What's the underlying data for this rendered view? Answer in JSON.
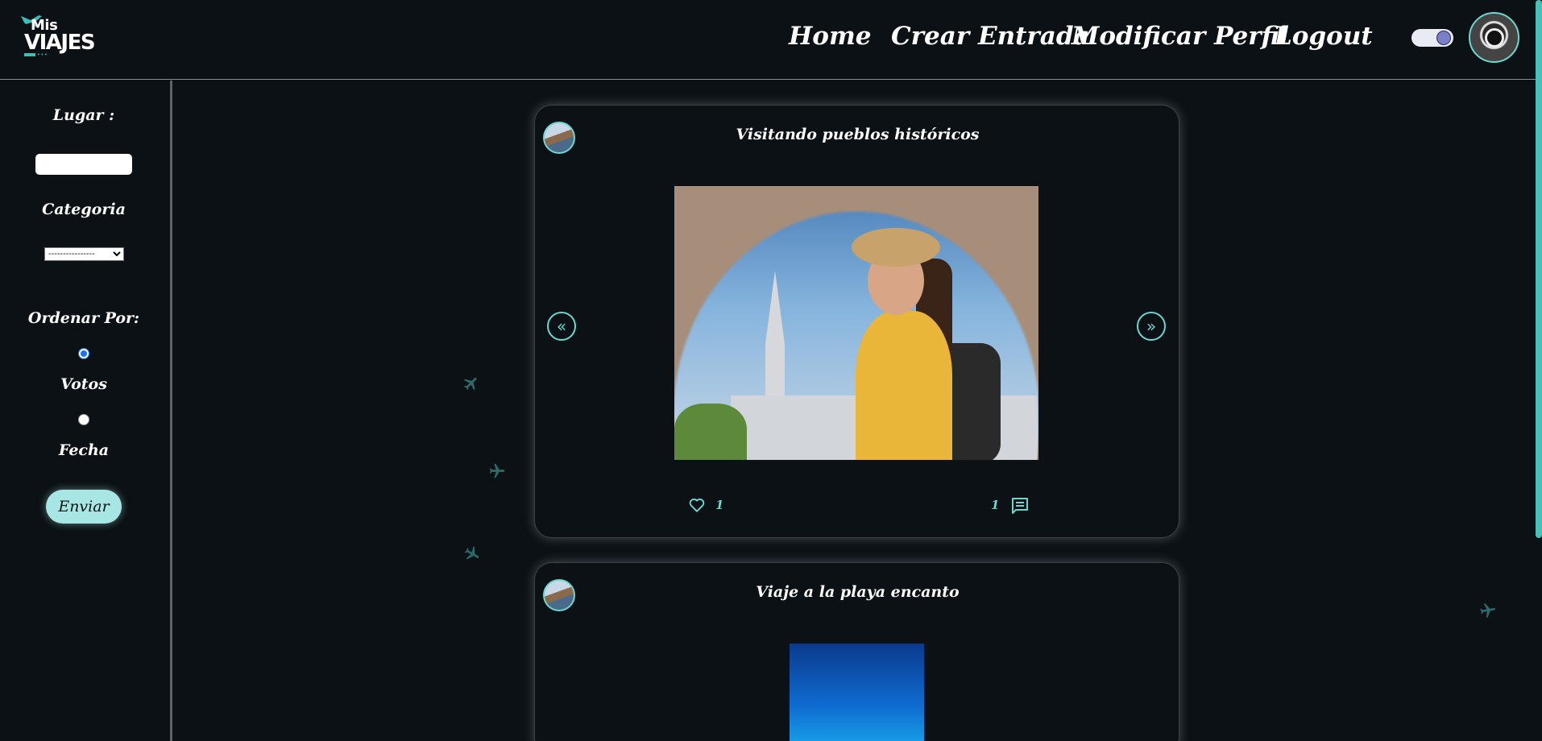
{
  "brand": {
    "line1": "Mis",
    "line2": "VIAJES",
    "dots": "•••"
  },
  "nav": {
    "home": "Home",
    "create": "Crear Entrada",
    "profile": "Modificar Perfil",
    "logout": "Logout"
  },
  "sidebar": {
    "lugar_label": "Lugar :",
    "lugar_value": "",
    "categoria_label": "Categoria",
    "categoria_selected": "----------------",
    "ordenar_label": "Ordenar Por:",
    "options": [
      "Votos",
      "Fecha"
    ],
    "selected_option": "Votos",
    "submit_label": "Enviar"
  },
  "posts": [
    {
      "title": "Visitando pueblos históricos",
      "likes": "1",
      "comments": "1",
      "image": "woman-in-arch-photo"
    },
    {
      "title": "Viaje a la playa encanto",
      "image": "blue-sky-photo"
    }
  ],
  "icons": {
    "prev": "«",
    "next": "»"
  },
  "colors": {
    "background": "#0b1115",
    "accent": "#6fd6cf",
    "button": "#a7e6e2"
  }
}
